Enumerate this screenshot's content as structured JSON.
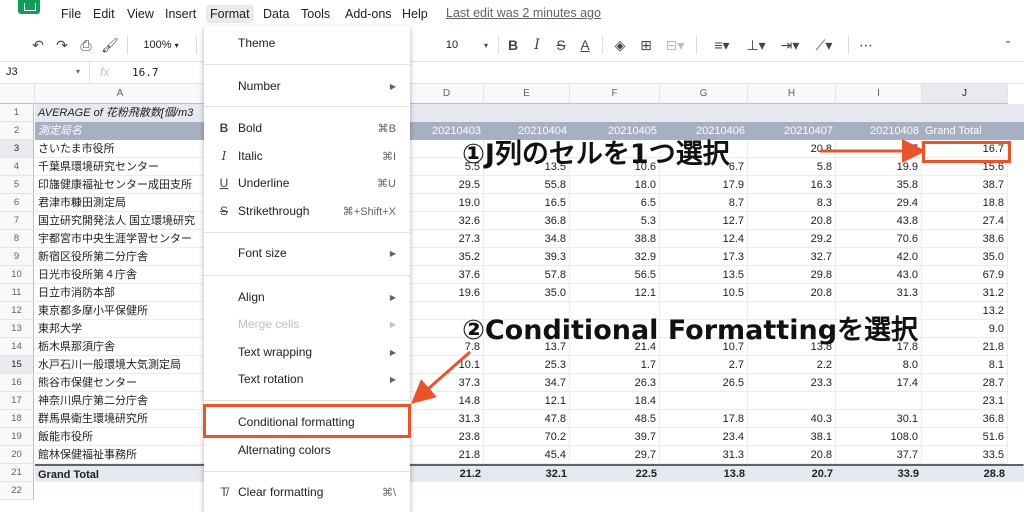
{
  "menubar": {
    "items": [
      "File",
      "Edit",
      "View",
      "Insert",
      "Format",
      "Data",
      "Tools",
      "Add-ons",
      "Help"
    ],
    "last_edit": "Last edit was 2 minutes ago"
  },
  "toolbar": {
    "zoom": "100%",
    "font_size": "10"
  },
  "formula_bar": {
    "name_box": "J3",
    "fx": "fx",
    "value": "16.7"
  },
  "columns": [
    "A",
    "B",
    "C",
    "D",
    "E",
    "F",
    "G",
    "H",
    "I",
    "J"
  ],
  "row_numbers": [
    "1",
    "2",
    "3",
    "4",
    "5",
    "6",
    "7",
    "8",
    "9",
    "10",
    "11",
    "12",
    "13",
    "14",
    "15",
    "16",
    "17",
    "18",
    "19",
    "20",
    "21",
    "22"
  ],
  "sheet": {
    "a1": "AVERAGE of 花粉飛散数[個/m3",
    "a2": "測定局名",
    "header_dates": [
      "20210403",
      "20210404",
      "20210405",
      "20210406",
      "20210407",
      "20210408"
    ],
    "grand_total_label": "Grand Total",
    "stations": [
      "さいたま市役所",
      "千葉県環境研究センター",
      "印旛健康福祉センター成田支所",
      "君津市糠田測定局",
      "国立研究開発法人 国立環境研究",
      "宇都宮市中央生涯学習センター",
      "新宿区役所第二分庁舎",
      "日光市役所第４庁舎",
      "日立市消防本部",
      "東京都多摩小平保健所",
      "東邦大学",
      "栃木県那須庁舎",
      "水戸石川一般環境大気測定局",
      "熊谷市保健センター",
      "神奈川県庁第二分庁舎",
      "群馬県衛生環境研究所",
      "飯能市役所",
      "館林保健福祉事務所"
    ],
    "rows": [
      [
        "",
        "",
        "",
        "",
        "20.8",
        "7",
        "16.7"
      ],
      [
        "5.5",
        "13.5",
        "10.6",
        "6.7",
        "5.8",
        "19.9",
        "15.6"
      ],
      [
        "29.5",
        "55.8",
        "18.0",
        "17.9",
        "16.3",
        "35.8",
        "38.7"
      ],
      [
        "19.0",
        "16.5",
        "6.5",
        "8.7",
        "8.3",
        "29.4",
        "18.8"
      ],
      [
        "32.6",
        "36.8",
        "5.3",
        "12.7",
        "20.8",
        "43.8",
        "27.4"
      ],
      [
        "27.3",
        "34.8",
        "38.8",
        "12.4",
        "29.2",
        "70.6",
        "38.6"
      ],
      [
        "35.2",
        "39.3",
        "32.9",
        "17.3",
        "32.7",
        "42.0",
        "35.0"
      ],
      [
        "37.6",
        "57.8",
        "56.5",
        "13.5",
        "29.8",
        "43.0",
        "67.9"
      ],
      [
        "19.6",
        "35.0",
        "12.1",
        "10.5",
        "20.8",
        "31.3",
        "31.2"
      ],
      [
        "",
        "",
        "",
        "",
        "",
        "",
        "13.2"
      ],
      [
        "",
        "",
        "",
        "",
        "",
        "",
        "9.0"
      ],
      [
        "7.8",
        "13.7",
        "21.4",
        "10.7",
        "13.8",
        "17.8",
        "21.8"
      ],
      [
        "10.1",
        "25.3",
        "1.7",
        "2.7",
        "2.2",
        "8.0",
        "8.1"
      ],
      [
        "37.3",
        "34.7",
        "26.3",
        "26.5",
        "23.3",
        "17.4",
        "28.7"
      ],
      [
        "14.8",
        "12.1",
        "18.4",
        "",
        "",
        "",
        "23.1"
      ],
      [
        "31.3",
        "47.8",
        "48.5",
        "17.8",
        "40.3",
        "30.1",
        "36.8"
      ],
      [
        "23.8",
        "70.2",
        "39.7",
        "23.4",
        "38.1",
        "108.0",
        "51.6"
      ],
      [
        "21.8",
        "45.4",
        "29.7",
        "31.3",
        "20.8",
        "37.7",
        "33.5"
      ]
    ],
    "total_label": "Grand Total",
    "totals": [
      "21.2",
      "32.1",
      "22.5",
      "13.8",
      "20.7",
      "33.9",
      "28.8"
    ]
  },
  "format_menu": {
    "theme": "Theme",
    "number": "Number",
    "bold": "Bold",
    "bold_sc": "⌘B",
    "italic": "Italic",
    "italic_sc": "⌘I",
    "underline": "Underline",
    "underline_sc": "⌘U",
    "strikethrough": "Strikethrough",
    "strikethrough_sc": "⌘+Shift+X",
    "font_size": "Font size",
    "align": "Align",
    "merge_cells": "Merge cells",
    "text_wrapping": "Text wrapping",
    "text_rotation": "Text rotation",
    "conditional_formatting": "Conditional formatting",
    "alternating_colors": "Alternating colors",
    "clear_formatting": "Clear formatting",
    "clear_formatting_sc": "⌘\\"
  },
  "annotations": {
    "step1": "①J列のセルを1つ選択",
    "step2": "②Conditional Formattingを選択",
    "color": "#e8542b"
  }
}
